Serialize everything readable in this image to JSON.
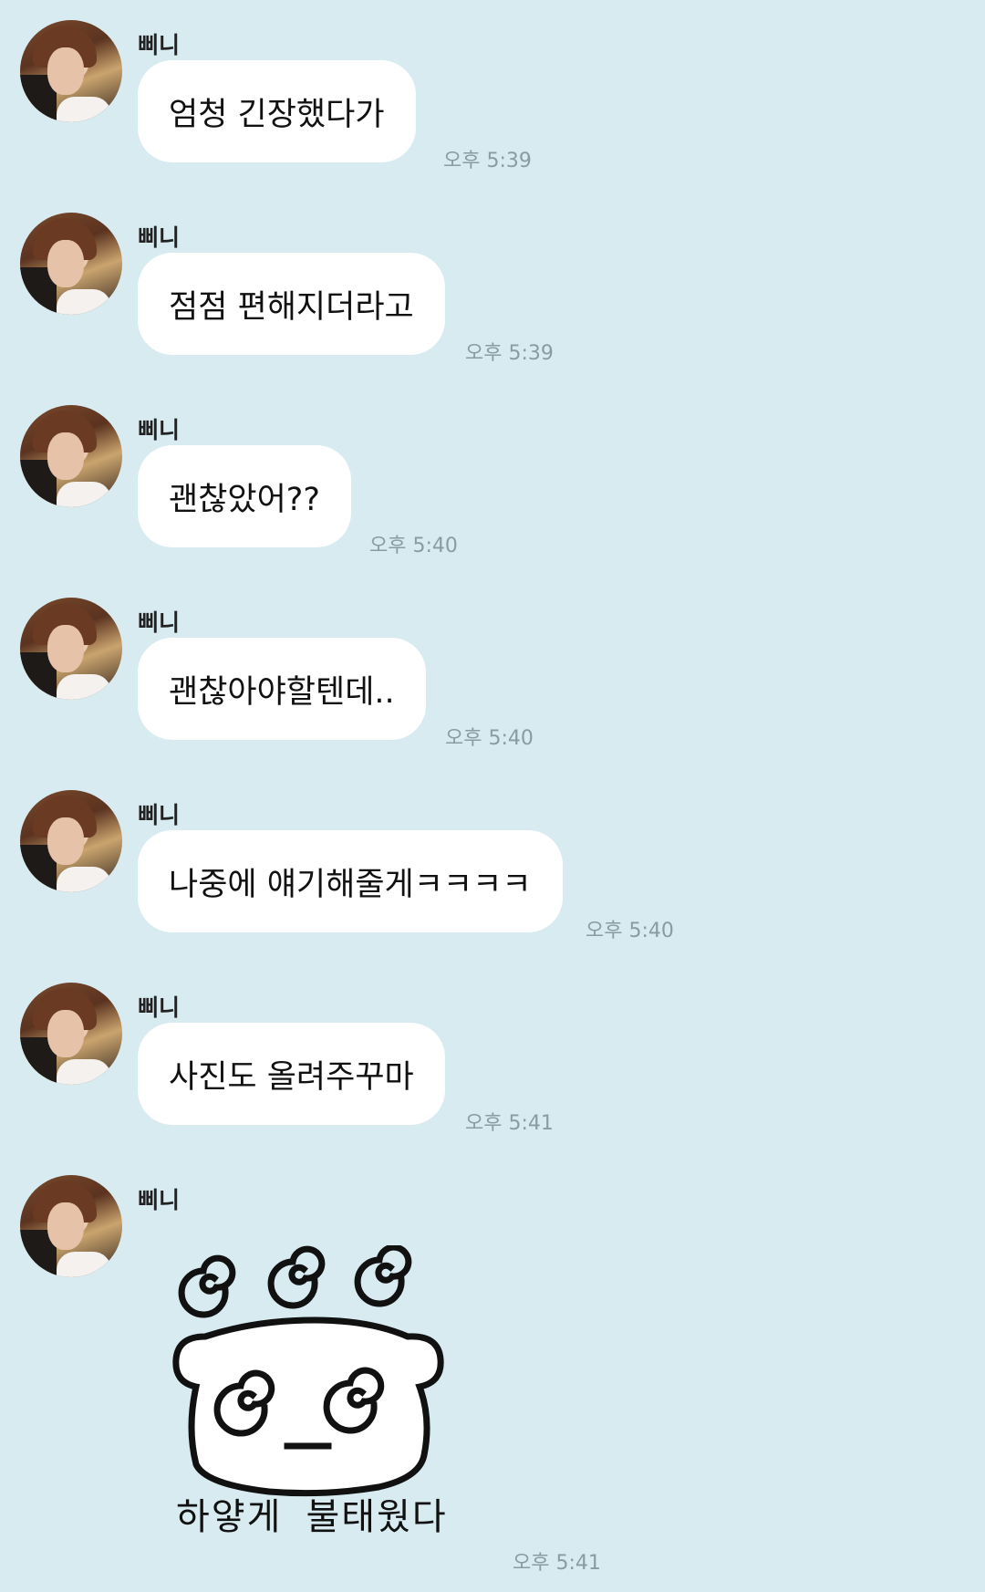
{
  "sender_name": "삐니",
  "messages": [
    {
      "text": "엄청 긴장했다가",
      "time": "오후 5:39"
    },
    {
      "text": "점점 편해지더라고",
      "time": "오후 5:39"
    },
    {
      "text": "괜찮았어??",
      "time": "오후 5:40"
    },
    {
      "text": "괜찮아야할텐데..",
      "time": "오후 5:40"
    },
    {
      "text": "나중에 얘기해줄게ㅋㅋㅋㅋ",
      "time": "오후 5:40"
    },
    {
      "text": "사진도 올려주꾸마",
      "time": "오후 5:41"
    }
  ],
  "sticker": {
    "caption": "하얗게 불태웠다",
    "time": "오후 5:41",
    "icon": "sticker-bear-swirl-icon"
  }
}
